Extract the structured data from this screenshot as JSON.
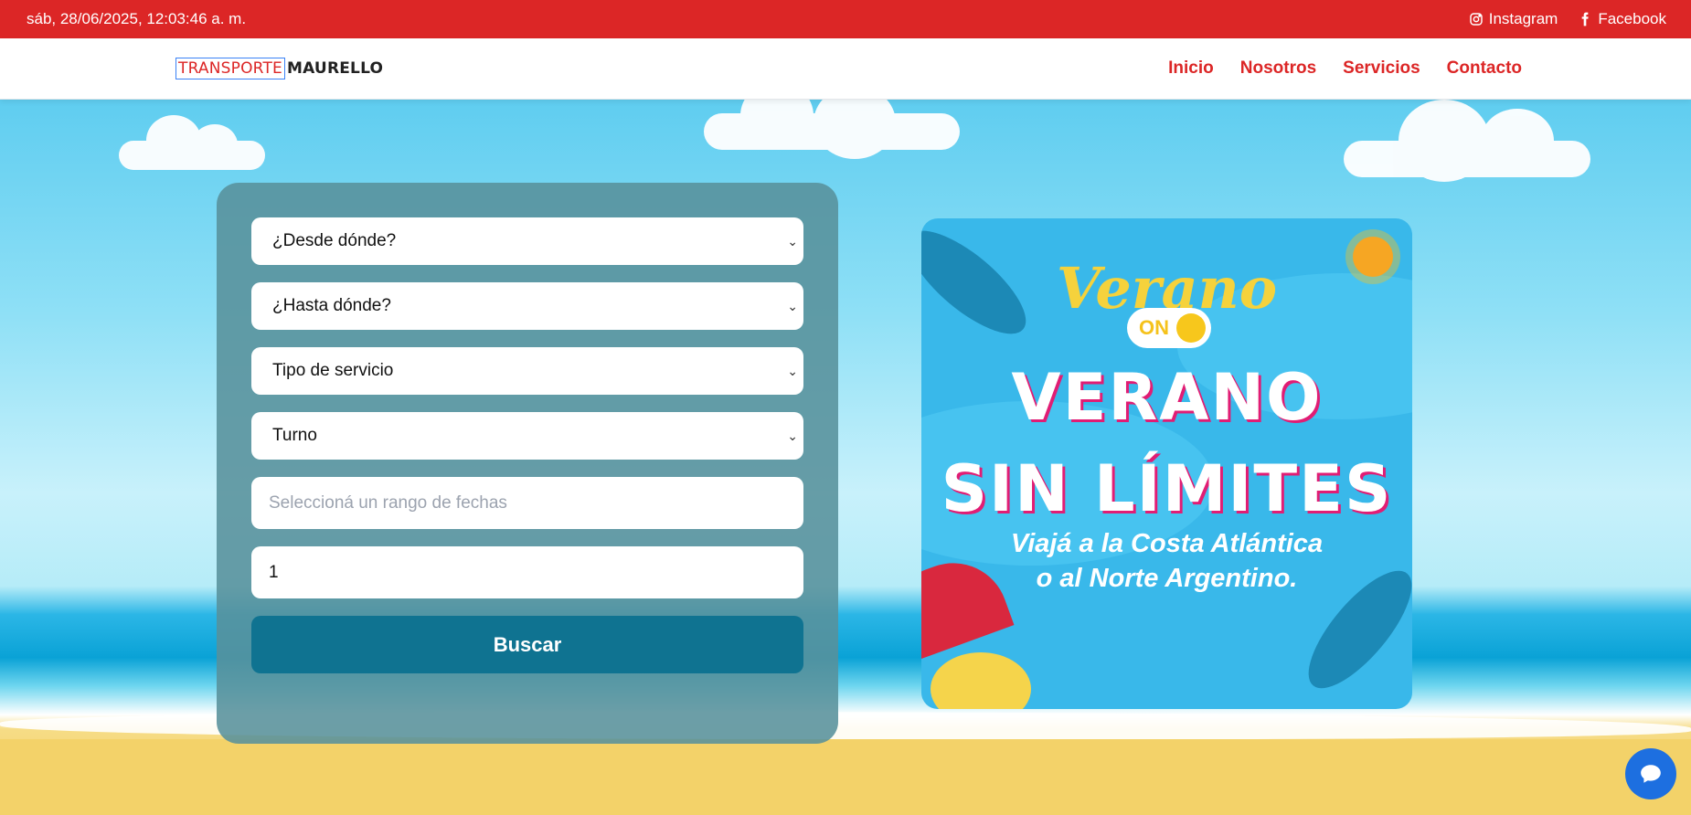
{
  "topbar": {
    "datetime": "sáb, 28/06/2025, 12:03:46 a. m.",
    "instagram_label": "Instagram",
    "facebook_label": "Facebook",
    "instagram_icon": "instagram-icon",
    "facebook_icon": "facebook-icon",
    "background_color": "#dc2626"
  },
  "navbar": {
    "logo_part1": "TRANSPORTE",
    "logo_part2": "MAURELLO",
    "links": [
      "Inicio",
      "Nosotros",
      "Servicios",
      "Contacto"
    ],
    "link_color": "#dc2626"
  },
  "search": {
    "from_placeholder": "¿Desde dónde?",
    "to_placeholder": "¿Hasta dónde?",
    "service_type": "Tipo de servicio",
    "shift": "Turno",
    "date_range_placeholder": "Seleccioná un rango de fechas",
    "passengers": "1",
    "button_label": "Buscar",
    "button_color": "#0f7391"
  },
  "promo": {
    "script_title": "Verano",
    "toggle_label": "ON",
    "headline_line1": "VERANO",
    "headline_line2": "SIN LÍMITES",
    "subtitle_line1": "Viajá a la Costa Atlántica",
    "subtitle_line2": "o al Norte Argentino."
  },
  "chat": {
    "icon": "chat-icon",
    "color": "#1d6fe0"
  }
}
